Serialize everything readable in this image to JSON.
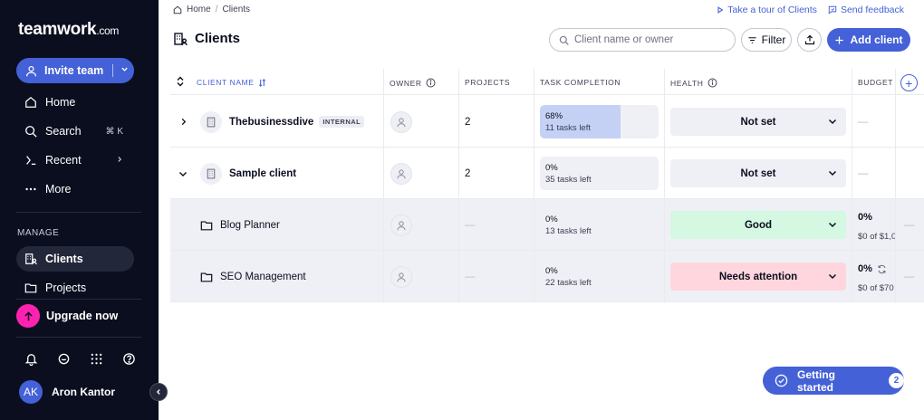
{
  "sidebar": {
    "logo": "teamwork",
    "logo_suffix": ".com",
    "invite_label": "Invite team",
    "nav": [
      {
        "label": "Home",
        "icon": "home-icon"
      },
      {
        "label": "Search",
        "icon": "search-icon",
        "hint": "⌘ K"
      },
      {
        "label": "Recent",
        "icon": "recent-icon"
      },
      {
        "label": "More",
        "icon": "more-icon"
      }
    ],
    "section_label": "MANAGE",
    "manage": [
      {
        "label": "Clients",
        "icon": "clients-icon",
        "active": true
      },
      {
        "label": "Projects",
        "icon": "folder-icon"
      }
    ],
    "upgrade_label": "Upgrade now",
    "user": {
      "initials": "AK",
      "name": "Aron Kantor"
    }
  },
  "breadcrumb": {
    "home": "Home",
    "current": "Clients"
  },
  "top_links": {
    "tour": "Take a tour of Clients",
    "feedback": "Send feedback"
  },
  "page_title": "Clients",
  "search": {
    "placeholder": "Client name or owner"
  },
  "filter_label": "Filter",
  "add_label": "Add client",
  "table": {
    "headers": {
      "client_name": "CLIENT NAME",
      "owner": "OWNER",
      "projects": "PROJECTS",
      "task_completion": "TASK COMPLETION",
      "health": "HEALTH",
      "budget": "BUDGET"
    },
    "dash": "—",
    "rows": [
      {
        "name": "Thebusinessdive",
        "badge": "INTERNAL",
        "projects": "2",
        "completion_pct": "68%",
        "completion_fraction": 0.68,
        "tasks_left": "11 tasks left",
        "health": "Not set"
      },
      {
        "name": "Sample client",
        "projects": "2",
        "completion_pct": "0%",
        "completion_fraction": 0,
        "tasks_left": "35 tasks left",
        "health": "Not set"
      },
      {
        "name": "Blog Planner",
        "completion_pct": "0%",
        "tasks_left": "13 tasks left",
        "health": "Good",
        "budget_pct": "0%",
        "budget_amt": "$0 of $1,0"
      },
      {
        "name": "SEO Management",
        "completion_pct": "0%",
        "tasks_left": "22 tasks left",
        "health": "Needs attention",
        "budget_pct": "0%",
        "budget_amt": "$0 of $70"
      }
    ]
  },
  "colors": {
    "accent": "#4461d7",
    "sidebar_bg": "#0b0e1f",
    "good": "#d4f8e1",
    "needs_attention": "#ffd6dd",
    "upgrade": "#ff22b1"
  },
  "getting_started": {
    "label": "Getting started",
    "count": "2"
  }
}
